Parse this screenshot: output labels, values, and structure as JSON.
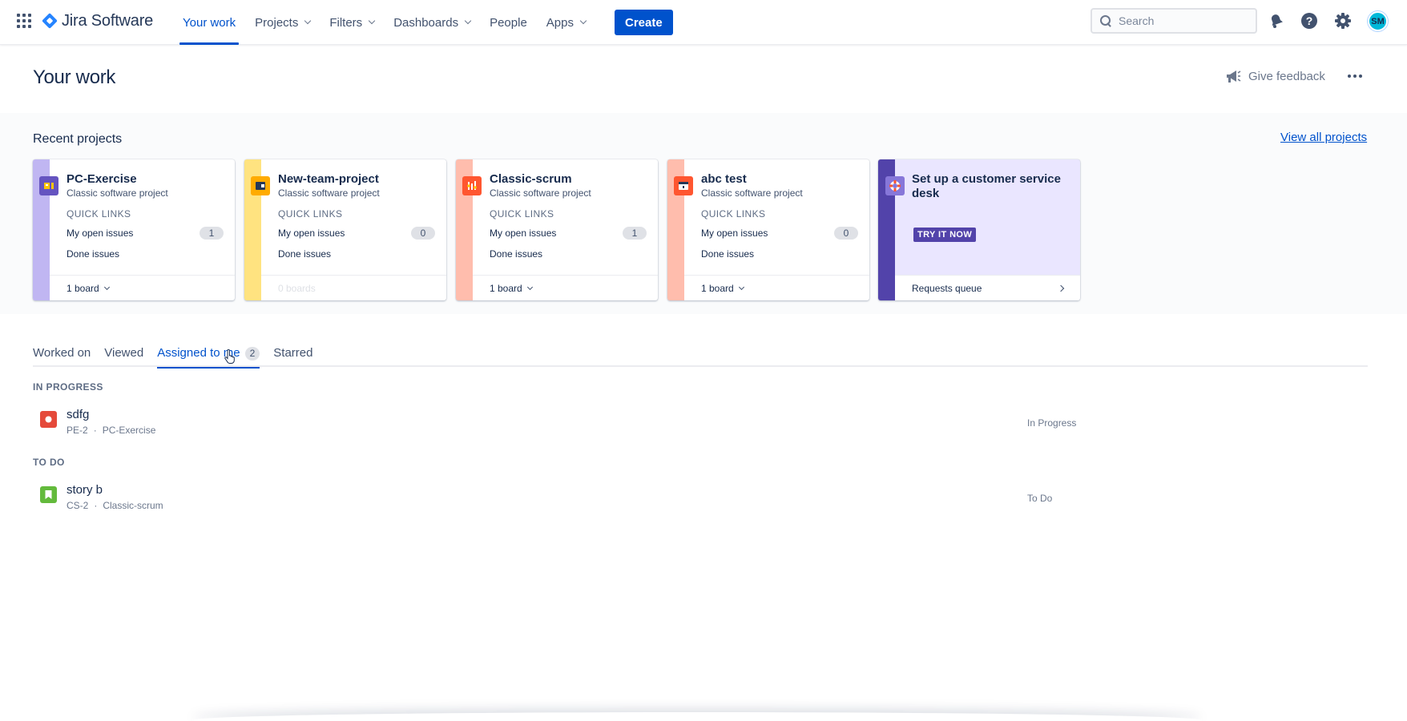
{
  "app": {
    "name": "Jira Software"
  },
  "nav": {
    "items": [
      {
        "label": "Your work",
        "active": true,
        "dropdown": false
      },
      {
        "label": "Projects",
        "active": false,
        "dropdown": true
      },
      {
        "label": "Filters",
        "active": false,
        "dropdown": true
      },
      {
        "label": "Dashboards",
        "active": false,
        "dropdown": true
      },
      {
        "label": "People",
        "active": false,
        "dropdown": false
      },
      {
        "label": "Apps",
        "active": false,
        "dropdown": true
      }
    ],
    "create_label": "Create",
    "search_placeholder": "Search",
    "avatar_initials": "SM"
  },
  "page": {
    "title": "Your work",
    "feedback_label": "Give feedback"
  },
  "recent": {
    "title": "Recent projects",
    "view_all": "View all projects",
    "quick_links_label": "QUICK LINKS",
    "open_issues_label": "My open issues",
    "done_issues_label": "Done issues",
    "projects": [
      {
        "name": "PC-Exercise",
        "type": "Classic software project",
        "open_count": "1",
        "boards": "1 board",
        "strip_color": "#c0b6f2",
        "icon_color": "#6554c0"
      },
      {
        "name": "New-team-project",
        "type": "Classic software project",
        "open_count": "0",
        "boards": "0 boards",
        "strip_color": "#ffe380",
        "icon_color": "#ffab00"
      },
      {
        "name": "Classic-scrum",
        "type": "Classic software project",
        "open_count": "1",
        "boards": "1 board",
        "strip_color": "#ffbdad",
        "icon_color": "#ff5630"
      },
      {
        "name": "abc test",
        "type": "Classic software project",
        "open_count": "0",
        "boards": "1 board",
        "strip_color": "#ffbdad",
        "icon_color": "#ff5630"
      }
    ],
    "promo": {
      "title": "Set up a customer service desk",
      "button": "TRY IT NOW",
      "footer": "Requests queue"
    }
  },
  "tabs": [
    {
      "label": "Worked on",
      "active": false
    },
    {
      "label": "Viewed",
      "active": false
    },
    {
      "label": "Assigned to me",
      "active": true,
      "count": "2"
    },
    {
      "label": "Starred",
      "active": false
    }
  ],
  "sections": [
    {
      "heading": "IN PROGRESS",
      "issues": [
        {
          "summary": "sdfg",
          "key": "PE-2",
          "project": "PC-Exercise",
          "status": "In Progress",
          "type": "bug",
          "color": "#e5493a"
        }
      ]
    },
    {
      "heading": "TO DO",
      "issues": [
        {
          "summary": "story b",
          "key": "CS-2",
          "project": "Classic-scrum",
          "status": "To Do",
          "type": "story",
          "color": "#63ba3c"
        }
      ]
    }
  ],
  "separator": "·"
}
